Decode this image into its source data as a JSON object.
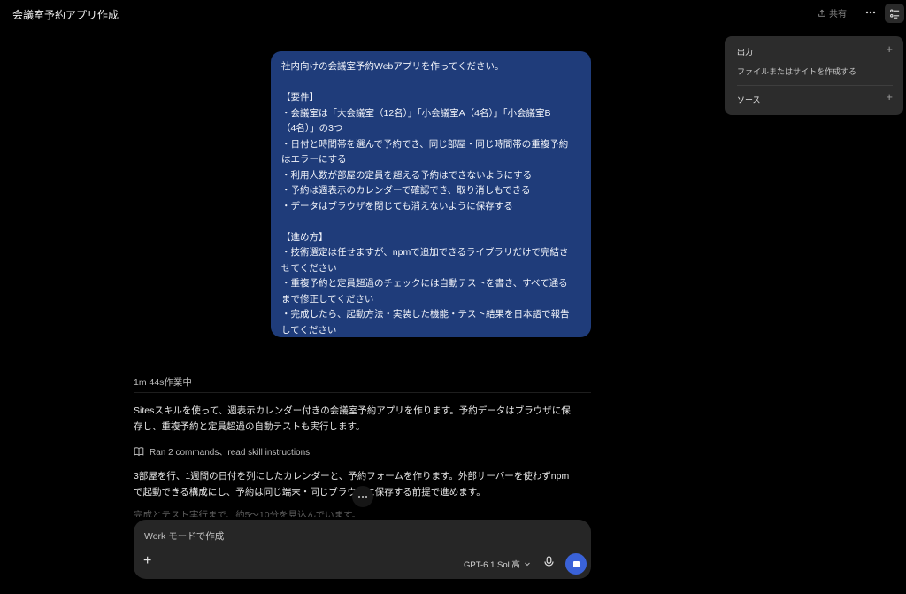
{
  "header": {
    "title": "会議室予約アプリ作成",
    "share_label": "共有",
    "more_icon": "more-horizontal-icon",
    "panel_icon": "panel-toggle-icon"
  },
  "side_panel": {
    "output_title": "出力",
    "output_description": "ファイルまたはサイトを作成する",
    "sources_title": "ソース"
  },
  "user_message": {
    "lines": [
      "社内向けの会議室予約Webアプリを作ってください。",
      "",
      "【要件】",
      "・会議室は「大会議室（12名）」「小会議室A（4名）」「小会議室B",
      "（4名）」の3つ",
      "・日付と時間帯を選んで予約でき、同じ部屋・同じ時間帯の重複予約",
      "はエラーにする",
      "・利用人数が部屋の定員を超える予約はできないようにする",
      "・予約は週表示のカレンダーで確認でき、取り消しもできる",
      "・データはブラウザを閉じても消えないように保存する",
      "",
      "【進め方】",
      "・技術選定は任せますが、npmで追加できるライブラリだけで完結さ",
      "せてください",
      "・重複予約と定員超過のチェックには自動テストを書き、すべて通る",
      "まで修正してください",
      "・完成したら、起動方法・実装した機能・テスト結果を日本語で報告",
      "してください"
    ]
  },
  "work_status": "1m 44s作業中",
  "assistant": {
    "paragraph_1_lines": [
      "Sitesスキルを使って、週表示カレンダー付きの会議室予約アプリを作ります。予約データはブラウザに保",
      "存し、重複予約と定員超過の自動テストも実行します。"
    ],
    "ran_label": "Ran 2 commands、read skill instructions",
    "paragraph_2_lines": [
      "3部屋を行、1週間の日付を列にしたカレンダーと、予約フォームを作ります。外部サーバーを使わずnpm",
      "で起動できる構成にし、予約は同じ端末・同じブラウザに保存する前提で進めます。"
    ],
    "paragraph_3_partial": "完成とテスト実行まで、約5〜10分を見込んでいます。"
  },
  "composer": {
    "placeholder": "Work モードで作成",
    "model_label": "GPT-6.1 Sol 高"
  },
  "colors": {
    "background": "#000000",
    "user_bubble": "#1f3c7a",
    "panel": "#2c2c2c",
    "composer": "#262626",
    "stop_button": "#3a62d8"
  }
}
